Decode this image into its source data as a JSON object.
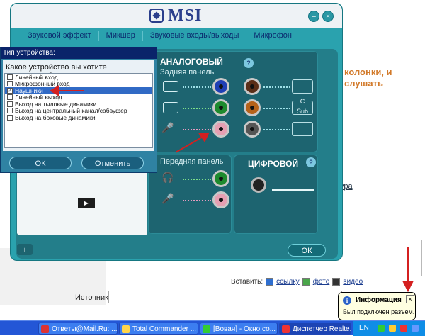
{
  "web": {
    "note": "колонки, и слушать",
    "link_fragment": "ура",
    "insert_label": "Вставить:",
    "insert_link": "ссылку",
    "insert_photo": "фото",
    "insert_video": "видео",
    "source_label": "Источник:"
  },
  "msi": {
    "logo": "MSI",
    "min_glyph": "–",
    "close_glyph": "×",
    "tabs": [
      "Звуковой эффект",
      "Микшер",
      "Звуковые входы/выходы",
      "Микрофон"
    ],
    "analog_title": "АНАЛОГОВЫЙ",
    "rear_panel": "Задняя панель",
    "front_panel": "Передняя панель",
    "digital_title": "ЦИФРОВОЙ",
    "speaker_labels": [
      "C",
      "Sub"
    ],
    "play_glyph": "▶",
    "info_glyph": "i",
    "help_glyph": "?",
    "ok_label": "ОК"
  },
  "dialog": {
    "title": "Тип устройства:",
    "question": "Какое устройство вы хотите подключить?",
    "options": [
      {
        "label": "Линейный вход",
        "checked": false
      },
      {
        "label": "Микрофонный вход",
        "checked": false
      },
      {
        "label": "Наушники",
        "checked": true
      },
      {
        "label": "Линейный выход",
        "checked": false
      },
      {
        "label": "Выход на тыловые динамики",
        "checked": false
      },
      {
        "label": "Выход на центральный канал/сабвуфер",
        "checked": false
      },
      {
        "label": "Выход на боковые динамики",
        "checked": false
      }
    ],
    "ok_label": "ОК",
    "cancel_label": "Отменить",
    "check_glyph": "✓"
  },
  "tooltip": {
    "title": "Информация",
    "text": "Был подключен разъем.",
    "close_glyph": "×",
    "icon_glyph": "i"
  },
  "taskbar": {
    "tasks": [
      "Ответы@Mail.Ru: ...",
      "Total Commander ...",
      "[Вован] - Окно со...",
      "Диспетчер Realte..."
    ],
    "language": "EN"
  },
  "colors": {
    "msi_body": "#2aa2ae",
    "panel": "#1d6470",
    "dialog_title": "#0a246a",
    "selection": "#316ac5",
    "annotation_red": "#d42020",
    "taskbar": "#2356d6"
  }
}
